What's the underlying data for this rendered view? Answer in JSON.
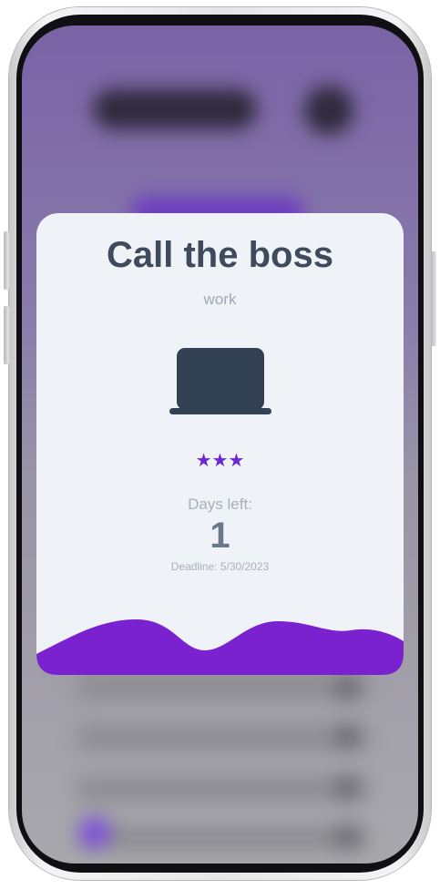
{
  "task": {
    "title": "Call the boss",
    "category": "work",
    "icon": "laptop-icon",
    "priority_stars": "★★★",
    "priority_level": 3,
    "days_left_label": "Days left:",
    "days_left_value": "1",
    "deadline_text": "Deadline: 5/30/2023"
  },
  "colors": {
    "accent": "#7b22d0",
    "card_background": "#eff2f7",
    "title": "#3f4a5c",
    "icon": "#334155"
  }
}
